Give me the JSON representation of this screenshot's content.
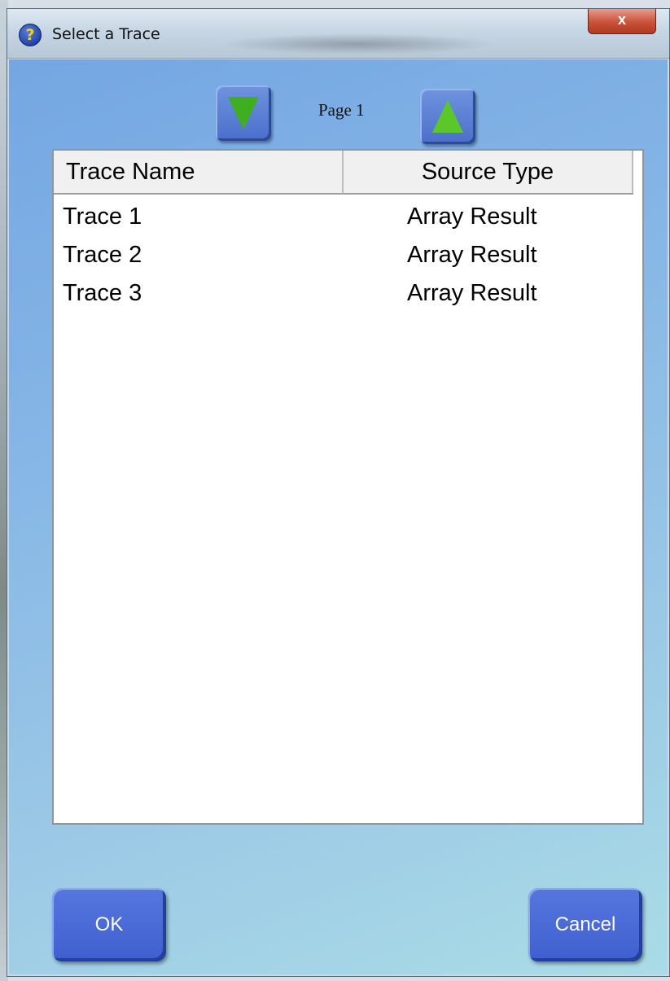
{
  "window": {
    "title": "Select a Trace",
    "help_icon_glyph": "?",
    "close_glyph": "x"
  },
  "pager": {
    "page_label": "Page 1",
    "down_icon": "green-triangle-down",
    "up_icon": "green-triangle-up"
  },
  "table": {
    "columns": [
      "Trace Name",
      "Source Type"
    ],
    "rows": [
      [
        "Trace 1",
        "Array Result"
      ],
      [
        "Trace 2",
        "Array Result"
      ],
      [
        "Trace 3",
        "Array Result"
      ]
    ]
  },
  "buttons": {
    "ok": "OK",
    "cancel": "Cancel"
  },
  "colors": {
    "button_blue": "#4a6fcb",
    "arrow_green": "#4db824",
    "close_red": "#c9513a"
  }
}
